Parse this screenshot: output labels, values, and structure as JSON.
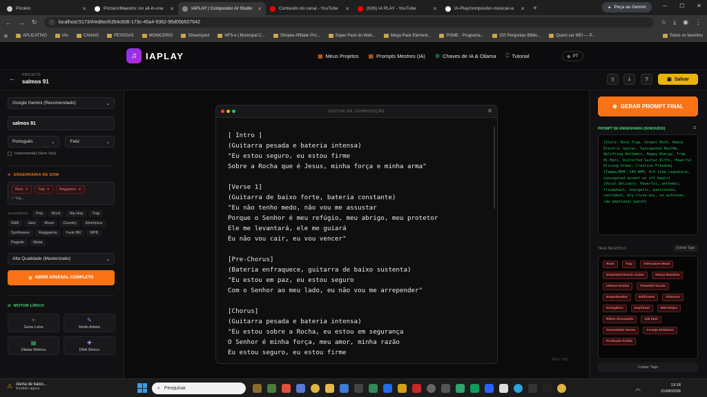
{
  "browser": {
    "tabs": [
      {
        "title": "Pinokio",
        "color": "#cccccc"
      },
      {
        "title": "Pizzaro/Maestro: An all-in-one",
        "color": "#ffffff"
      },
      {
        "title": "IAPLAY | Compositor AI Studio",
        "color": "#888888",
        "active": true
      },
      {
        "title": "Conteúdo do canal - YouTube",
        "color": "#ff0000"
      },
      {
        "title": "(626) IA PLAY - YouTube",
        "color": "#ff0000"
      },
      {
        "title": "IA-Play/compositor-musical-ia",
        "color": "#ffffff"
      }
    ],
    "new_tab": "+",
    "gemini_button": "Peça ao Gemini",
    "url": "localhost:5173/#/editor/6354c836-173c-45a4-9362-95d05b507642",
    "bookmarks": [
      "APLICATIVO",
      "IAs",
      "CANAIS",
      "PESSOAS",
      "MONICERIO",
      "Streamyard",
      "NFS-e | Municipal C...",
      "Shopee Affiliate Pro...",
      "Super Pack do Web...",
      "Mega Pack Element...",
      "PGME - Programa...",
      "150 Perguntas Bíblic...",
      "Quero ser MEI — P..."
    ],
    "bookmarks_right": "Todos os favoritos"
  },
  "app": {
    "brand": "IAPLAY",
    "nav": [
      {
        "label": "Meus Projetos",
        "glyph": "▦"
      },
      {
        "label": "Prompts Mestres (IA)",
        "glyph": "▦"
      },
      {
        "label": "Chaves de IA & Ollama",
        "glyph": "⚙"
      },
      {
        "label": "Tutorial",
        "glyph": "⎕"
      }
    ],
    "lang": "PT"
  },
  "project": {
    "label": "PROJETO",
    "name": "salmos 91",
    "save": "Salvar"
  },
  "left": {
    "model_select": "Google Gemini (Recomendado)",
    "title_value": "salmos 91",
    "language": "Português",
    "mood": "Feliz",
    "instrumental": "Instrumental (Sem Voz)",
    "sound_section": "ENGENHARIA DE SOM",
    "selected_tags": [
      "Rock",
      "Trap",
      "Reggaeton"
    ],
    "add_tag": "+ Tag...",
    "suggested_label": "SUGERIDOS:",
    "suggestions": [
      "Pop",
      "Rock",
      "Hip Hop",
      "Trap",
      "R&B",
      "Jazz",
      "Blues",
      "Country",
      "Eletrônica",
      "Synthwave",
      "Reggaeton",
      "Funk BR",
      "MPB",
      "Pagode",
      "Metal"
    ],
    "quality": "Alta Qualidade (Masterizado)",
    "arsenal_button": "ABRIR ARSENAL COMPLETO",
    "lyric_section": "MOTOR LÍRICO",
    "cards": [
      {
        "label": "Gerar Letra",
        "glyph": "✧",
        "color": "#f87171"
      },
      {
        "label": "Modo Artista",
        "glyph": "✎",
        "color": "#60a5fa"
      },
      {
        "label": "Dilatar Métrica",
        "glyph": "▤",
        "color": "#4ade80"
      },
      {
        "label": "DNA Sônico",
        "glyph": "✚",
        "color": "#c084fc"
      }
    ]
  },
  "editor": {
    "title": "EDITOR DE COMPOSIÇÃO",
    "char_count": "25·8 / ·000",
    "lyrics": "[ Intro ]\n(Guitarra pesada e bateria intensa)\n\"Eu estou seguro, eu estou firme\nSobre a Rocha que é Jesus, minha força e minha arma\"\n\n[Verse 1]\n(Guitarra de baixo forte, bateria constante)\n\"Eu não tenho medo, não vou me assustar\nPorque o Senhor é meu refúgio, meu abrigo, meu protetor\nEle me levantará, ele me guiará\nEu não vou cair, eu vou vencer\"\n\n[Pre-Chorus]\n(Bateria enfraquece, guitarra de baixo sustenta)\n\"Eu estou em paz, eu estou seguro\nCom o Senhor ao meu lado, eu não vou me arrepender\"\n\n[Chorus]\n(Guitarra pesada e bateria intensa)\n\"Eu estou sobre a Rocha, eu estou em segurança\nO Senhor é minha força, meu amor, minha razão\nEu estou seguro, eu estou firme"
  },
  "right": {
    "generate_button": "GERAR PROMPT FINAL",
    "prompt_title": "PROMPT DE ENGENHARIA (SUNO/UDIO)",
    "prompt_text": "[Style: Rock Trap, Gospel Rock, Heavy Electric Guitar, Syncopated Rhythm, Uplifting Anthemic, Happy Energy, Trap Hi-Hats, Distorted Guitar Riffs, Powerful Driving Drums, Creative Freedom]\n[Tempo/BPM: 145 BPM, 4/4 time signature, syncopated accent on off beats]\n[Vocal Delivery: Powerful, anthemic, triumphant, energetic, passionate, confident, dry close-mic, no autotune, raw emotional punch]",
    "tags_title": "TAGS DE ESTILO",
    "extract_button": "Extrair Tags",
    "tags": [
      "Rock",
      "Trap",
      "Alternative Metal",
      "Distorted Electric Guitar",
      "Heavy Bassline",
      "Intense Drums",
      "Powerful Vocals",
      "Empoderador",
      "Edificante",
      "Vitorioso",
      "Energético",
      "Espiritual",
      "Mid-tempo",
      "Ritmo Sincopado",
      "135 bpm",
      "Sonoridade Densa",
      "Arranjo Dinâmico",
      "Produção Polida"
    ],
    "copy_tags": "Copiar Tags"
  },
  "taskbar": {
    "alert_title": "Alerta de baixo...",
    "alert_sub": "Emitido agora",
    "search": "Pesquisar",
    "time": "13:18",
    "date": "21/08/2026"
  },
  "colors": {
    "accent": "#f97316",
    "save": "#eab308",
    "prompt_text": "#22c55e",
    "tag_red": "#f87171"
  }
}
